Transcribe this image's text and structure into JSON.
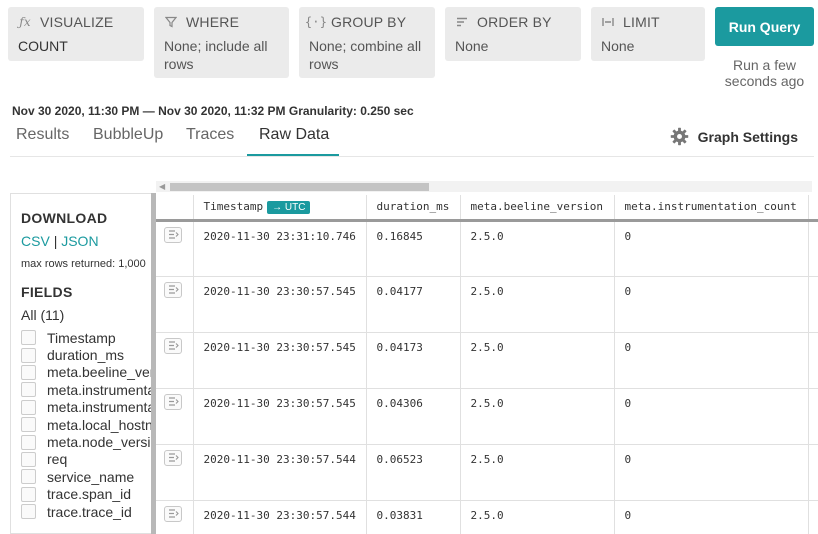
{
  "query": {
    "visualize": {
      "label": "VISUALIZE",
      "value": "COUNT"
    },
    "where": {
      "label": "WHERE",
      "value": "None; include all rows"
    },
    "group_by": {
      "label": "GROUP BY",
      "value": "None; combine all rows"
    },
    "order_by": {
      "label": "ORDER BY",
      "value": "None"
    },
    "limit": {
      "label": "LIMIT",
      "value": "None"
    },
    "run_button": "Run Query",
    "run_ago": "Run a few seconds ago"
  },
  "time_range": {
    "start": "Nov 30 2020, 11:30 PM",
    "separator": "—",
    "end": "Nov 30 2020, 11:32 PM",
    "granularity_label": "Granularity:",
    "granularity": "0.250 sec"
  },
  "tabs": [
    "Results",
    "BubbleUp",
    "Traces",
    "Raw Data"
  ],
  "active_tab": "Raw Data",
  "graph_settings": "Graph Settings",
  "sidebar": {
    "download_title": "DOWNLOAD",
    "csv": "CSV",
    "pipe": "|",
    "json": "JSON",
    "max_rows": "max rows returned: 1,000",
    "fields_title": "FIELDS",
    "all": "All (11)",
    "fields": [
      "Timestamp",
      "duration_ms",
      "meta.beeline_version",
      "meta.instrumentation_count",
      "meta.instrumentations",
      "meta.local_hostname",
      "meta.node_version",
      "req",
      "service_name",
      "trace.span_id",
      "trace.trace_id"
    ]
  },
  "table": {
    "columns": [
      "Timestamp",
      "duration_ms",
      "meta.beeline_version",
      "meta.instrumentation_count"
    ],
    "utc_badge": "→ UTC",
    "rows": [
      [
        "2020-11-30 23:31:10.746",
        "0.16845",
        "2.5.0",
        "0"
      ],
      [
        "2020-11-30 23:30:57.545",
        "0.04177",
        "2.5.0",
        "0"
      ],
      [
        "2020-11-30 23:30:57.545",
        "0.04173",
        "2.5.0",
        "0"
      ],
      [
        "2020-11-30 23:30:57.545",
        "0.04306",
        "2.5.0",
        "0"
      ],
      [
        "2020-11-30 23:30:57.544",
        "0.06523",
        "2.5.0",
        "0"
      ],
      [
        "2020-11-30 23:30:57.544",
        "0.03831",
        "2.5.0",
        "0"
      ]
    ]
  },
  "colors": {
    "accent": "#1b9a9f",
    "panel": "#ebebeb"
  },
  "icons": {
    "visualize": "fx-icon",
    "where": "filter-icon",
    "group_by": "group-icon",
    "order_by": "sort-icon",
    "limit": "limit-icon",
    "settings": "gear-icon",
    "row": "row-detail-icon"
  }
}
